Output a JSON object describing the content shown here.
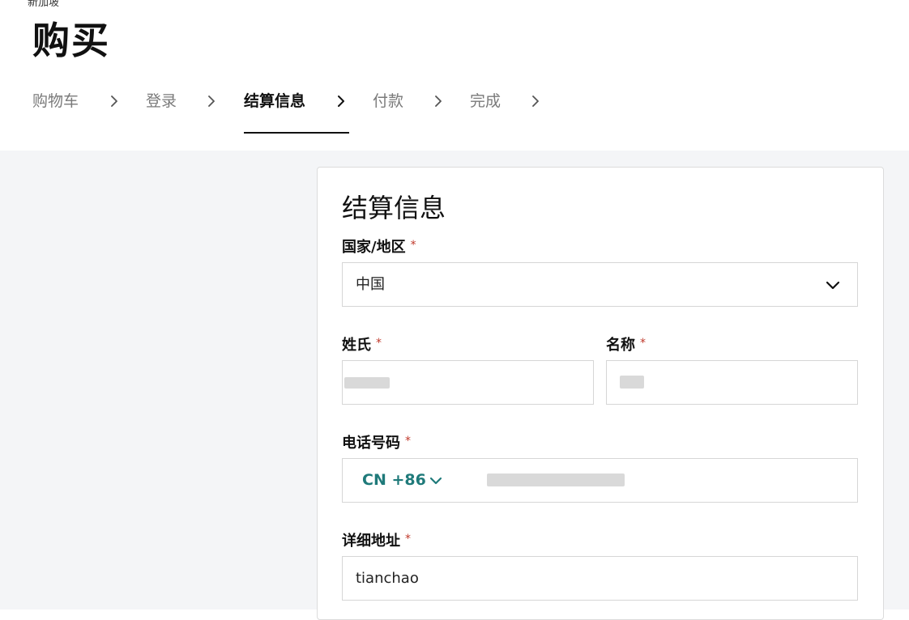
{
  "header": {
    "region_label": "新加坡",
    "title": "购买"
  },
  "steps": [
    {
      "label": "购物车",
      "active": false
    },
    {
      "label": "登录",
      "active": false
    },
    {
      "label": "结算信息",
      "active": true
    },
    {
      "label": "付款",
      "active": false
    },
    {
      "label": "完成",
      "active": false
    }
  ],
  "form": {
    "title": "结算信息",
    "required_mark": "*",
    "country": {
      "label": "国家/地区",
      "value": "中国"
    },
    "last_name": {
      "label": "姓氏",
      "value": ""
    },
    "first_name": {
      "label": "名称",
      "value": ""
    },
    "phone": {
      "label": "电话号码",
      "prefix": "CN +86",
      "value": ""
    },
    "address": {
      "label": "详细地址",
      "value": "tianchao"
    }
  },
  "icons": {
    "step_separator": "chevron-right-icon",
    "country_select": "chevron-down-icon",
    "phone_prefix": "chevron-down-icon"
  },
  "colors": {
    "accent_teal": "#1f7a7a",
    "required_red": "#c0392b",
    "page_gray": "#f4f5f7"
  }
}
